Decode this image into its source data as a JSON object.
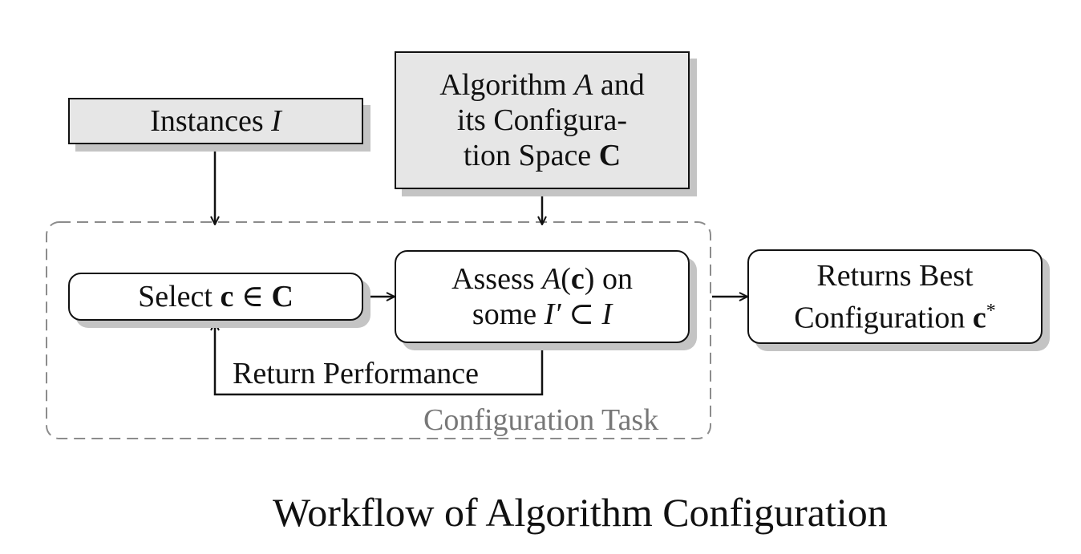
{
  "diagram": {
    "instances_box": {
      "text": "Instances",
      "math": "I"
    },
    "algorithm_box": {
      "line1": "Algorithm",
      "line1_math": "A",
      "line1_tail": "and",
      "line2": "its Configura-",
      "line3": "tion Space",
      "line3_math": "C"
    },
    "select_box": {
      "text": "Select",
      "var": "c",
      "op": "∈",
      "set": "C"
    },
    "assess_box": {
      "line1": "Assess",
      "line1_math": "A",
      "line1_arg": "c",
      "line1_tail": "on",
      "line2": "some",
      "line2_math": "I′",
      "line2_op": "⊂",
      "line2_set": "I"
    },
    "returns_box": {
      "line1": "Returns Best",
      "line2": "Configuration",
      "line2_math": "c",
      "line2_sup": "*"
    },
    "feedback_label": "Return Performance",
    "group_label": "Configuration Task",
    "caption": "Workflow of Algorithm Configuration"
  },
  "colors": {
    "box_fill_gray": "#e6e6e6",
    "shadow": "#c4c4c4",
    "dashed_border": "#8c8c8c",
    "group_label": "#777777",
    "stroke": "#111111"
  }
}
